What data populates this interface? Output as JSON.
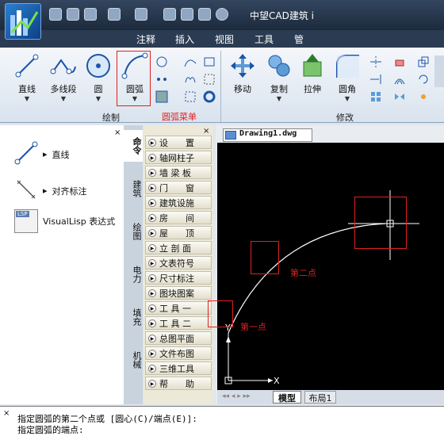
{
  "app": {
    "title": "中望CAD建筑 i"
  },
  "tabs": [
    "注释",
    "插入",
    "视图",
    "工具",
    "管"
  ],
  "ribbon": {
    "draw_buttons": [
      "直线",
      "多线段",
      "圆",
      "圆弧"
    ],
    "modify_buttons": [
      "移动",
      "复制",
      "拉伸",
      "圆角"
    ],
    "group_draw": "绘制",
    "group_modify": "修改",
    "arc_menu_annotation": "圆弧菜单"
  },
  "left_panel": {
    "items": [
      "直线",
      "对齐标注",
      "VisualLisp 表达式"
    ],
    "lsp_icon": "LSP"
  },
  "vertical_tabs": [
    "命令",
    "建筑",
    "绘图",
    "电力",
    "填充",
    "机械"
  ],
  "menu": [
    "设　　置",
    "轴网柱子",
    "墙 梁 板",
    "门　　窗",
    "建筑设施",
    "房　　间",
    "屋　　顶",
    "立 剖 面",
    "文表符号",
    "尺寸标注",
    "图块图案",
    "工 具 一",
    "工 具 二",
    "总图平面",
    "文件布图",
    "三维工具",
    "帮　　助"
  ],
  "document": {
    "tab": "Drawing1.dwg",
    "layout_tabs": [
      "模型",
      "布局1"
    ],
    "axis_x": "X",
    "axis_y": "Y"
  },
  "annotations": {
    "first_point": "第一点",
    "second_point": "第二点"
  },
  "command": {
    "line1": "指定圆弧的第二个点或 [圆心(C)/端点(E)]:",
    "line2": "指定圆弧的端点:"
  },
  "colors": {
    "annotation_red": "#e02020"
  }
}
